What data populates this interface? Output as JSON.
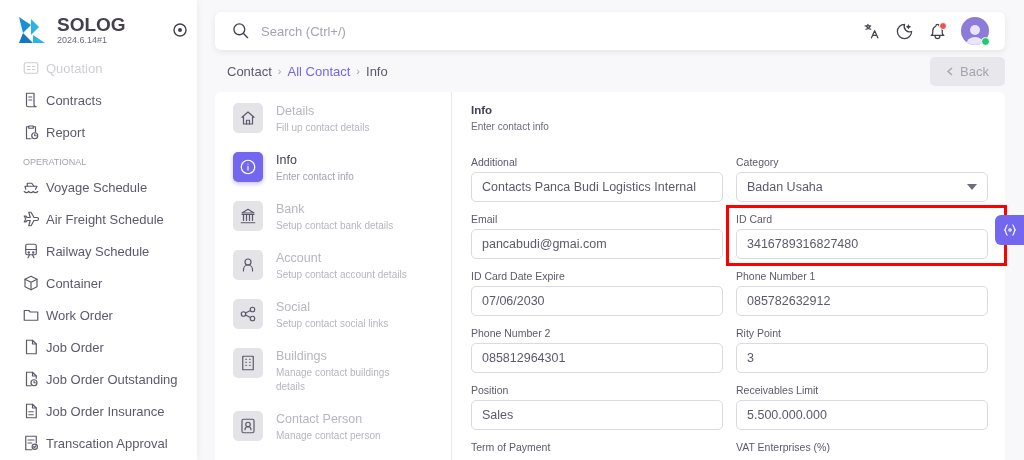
{
  "brand": {
    "name": "SOLOG",
    "version": "2024.6.14#1"
  },
  "sidebar": {
    "items": [
      {
        "kind": "item",
        "label": "Quotation",
        "dimmed": true
      },
      {
        "kind": "item",
        "label": "Contracts",
        "dimmed": false
      },
      {
        "kind": "item",
        "label": "Report",
        "dimmed": false
      },
      {
        "kind": "header",
        "label": "OPERATIONAL"
      },
      {
        "kind": "item",
        "label": "Voyage Schedule",
        "dimmed": false
      },
      {
        "kind": "item",
        "label": "Air Freight Schedule",
        "dimmed": false
      },
      {
        "kind": "item",
        "label": "Railway Schedule",
        "dimmed": false
      },
      {
        "kind": "item",
        "label": "Container",
        "dimmed": false
      },
      {
        "kind": "item",
        "label": "Work Order",
        "dimmed": false
      },
      {
        "kind": "item",
        "label": "Job Order",
        "dimmed": false
      },
      {
        "kind": "item",
        "label": "Job Order Outstanding",
        "dimmed": false
      },
      {
        "kind": "item",
        "label": "Job Order Insurance",
        "dimmed": false
      },
      {
        "kind": "item",
        "label": "Transcation Approval",
        "dimmed": false
      }
    ]
  },
  "search": {
    "placeholder": "Search (Ctrl+/)"
  },
  "notifications": {
    "unread": true
  },
  "breadcrumb": [
    {
      "kind": "text",
      "label": "Contact"
    },
    {
      "kind": "separator",
      "label": "›"
    },
    {
      "kind": "link",
      "label": "All Contact"
    },
    {
      "kind": "separator",
      "label": "›"
    },
    {
      "kind": "text",
      "label": "Info"
    }
  ],
  "back_button": {
    "label": "Back",
    "disabled": true
  },
  "steps": [
    {
      "title": "Details",
      "subtitle": "Fill up contact details",
      "selected": false
    },
    {
      "title": "Info",
      "subtitle": "Enter contact info",
      "selected": true
    },
    {
      "title": "Bank",
      "subtitle": "Setup contact bank details",
      "selected": false
    },
    {
      "title": "Account",
      "subtitle": "Setup contact account details",
      "selected": false
    },
    {
      "title": "Social",
      "subtitle": "Setup contact social links",
      "selected": false
    },
    {
      "title": "Buildings",
      "subtitle": "Manage contact buildings details",
      "selected": false
    },
    {
      "title": "Contact Person",
      "subtitle": "Manage contact person",
      "selected": false
    }
  ],
  "form": {
    "title": "Info",
    "subtitle": "Enter contact info",
    "fields": [
      {
        "kind": "input",
        "label": "Additional",
        "value": "Contacts Panca Budi Logistics Internal",
        "highlighted": false
      },
      {
        "kind": "select",
        "label": "Category",
        "value": "Badan Usaha",
        "highlighted": false
      },
      {
        "kind": "input",
        "label": "Email",
        "value": "pancabudi@gmai.com",
        "highlighted": false
      },
      {
        "kind": "input",
        "label": "ID Card",
        "value": "3416789316827480",
        "highlighted": true
      },
      {
        "kind": "input",
        "label": "ID Card Date Expire",
        "value": "07/06/2030",
        "highlighted": false
      },
      {
        "kind": "input",
        "label": "Phone Number 1",
        "value": "085782632912",
        "highlighted": false
      },
      {
        "kind": "input",
        "label": "Phone Number 2",
        "value": "085812964301",
        "highlighted": false
      },
      {
        "kind": "input",
        "label": "Rity Point",
        "value": "3",
        "highlighted": false
      },
      {
        "kind": "input",
        "label": "Position",
        "value": "Sales",
        "highlighted": false
      },
      {
        "kind": "input",
        "label": "Receivables Limit",
        "value": "5.500.000.000",
        "highlighted": false
      },
      {
        "label": "Term of Payment",
        "highlighted": false
      },
      {
        "label": "VAT Enterprises (%)",
        "highlighted": false
      }
    ]
  }
}
